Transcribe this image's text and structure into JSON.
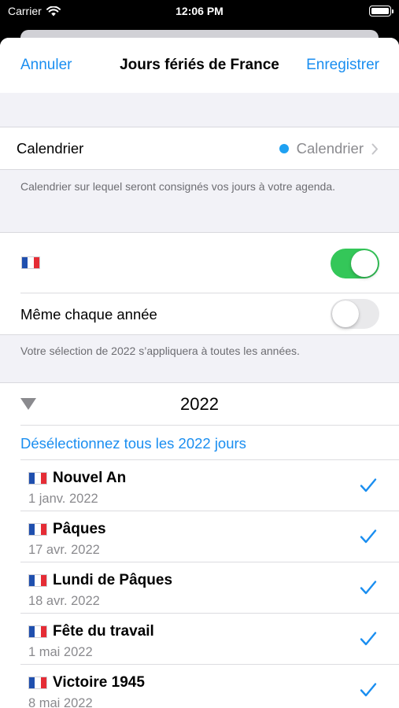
{
  "status_bar": {
    "carrier": "Carrier",
    "time": "12:06 PM"
  },
  "nav": {
    "cancel": "Annuler",
    "title": "Jours fériés de France",
    "save": "Enregistrer"
  },
  "calendar": {
    "label": "Calendrier",
    "value": "Calendrier",
    "dot_color": "#1fa1f2",
    "footnote": "Calendrier sur lequel seront consignés vos jours à votre agenda."
  },
  "country": {
    "flag_icon": "france-flag-icon",
    "enabled": true
  },
  "same_each_year": {
    "label": "Même chaque année",
    "enabled": false,
    "footnote": "Votre sélection de 2022 s’appliquera à toutes les années."
  },
  "year_section": {
    "year": "2022",
    "deselect_label": "Désélectionnez tous les 2022 jours",
    "holidays": [
      {
        "name": "Nouvel An",
        "date": "1 janv. 2022",
        "checked": true
      },
      {
        "name": "Pâques",
        "date": "17 avr. 2022",
        "checked": true
      },
      {
        "name": "Lundi de Pâques",
        "date": "18 avr. 2022",
        "checked": true
      },
      {
        "name": "Fête du travail",
        "date": "1 mai 2022",
        "checked": true
      },
      {
        "name": "Victoire 1945",
        "date": "8 mai 2022",
        "checked": true
      }
    ]
  },
  "colors": {
    "accent": "#1a8ef0",
    "toggle_on": "#34c759",
    "secondary_text": "#8a8a8e"
  }
}
